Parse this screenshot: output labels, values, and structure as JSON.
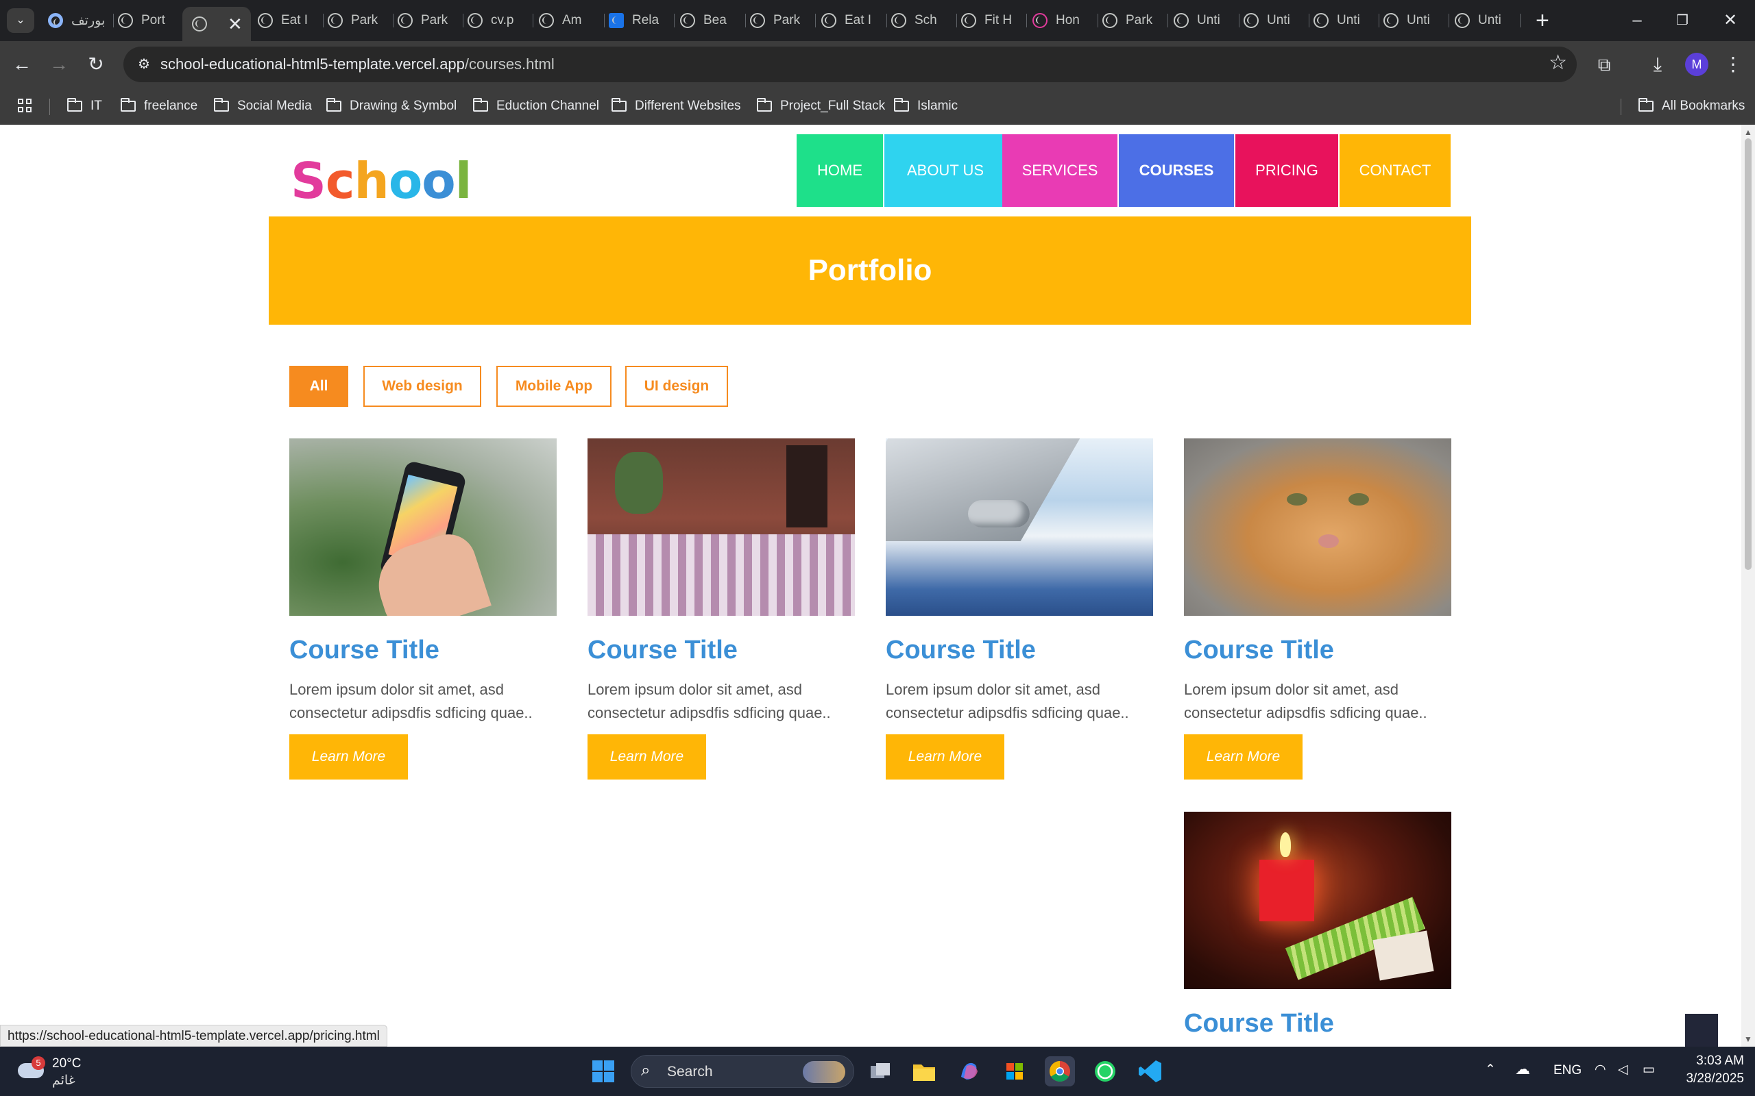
{
  "browser": {
    "tabs": [
      {
        "title": "بورتف",
        "favicon": "circle-icon"
      },
      {
        "title": "Port",
        "favicon": "globe-icon"
      },
      {
        "title": "",
        "favicon": "globe-icon",
        "active": true
      },
      {
        "title": "Eat I",
        "favicon": "globe-icon"
      },
      {
        "title": "Park",
        "favicon": "globe-icon"
      },
      {
        "title": "Park",
        "favicon": "globe-icon"
      },
      {
        "title": "cv.p",
        "favicon": "globe-icon"
      },
      {
        "title": "Am",
        "favicon": "spade-icon"
      },
      {
        "title": "Rela",
        "favicon": "play-icon"
      },
      {
        "title": "Bea",
        "favicon": "spade-icon"
      },
      {
        "title": "Park",
        "favicon": "globe-icon"
      },
      {
        "title": "Eat I",
        "favicon": "globe-icon"
      },
      {
        "title": "Sch",
        "favicon": "globe-icon"
      },
      {
        "title": "Fit H",
        "favicon": "globe-icon"
      },
      {
        "title": "Hon",
        "favicon": "angular-icon"
      },
      {
        "title": "Park",
        "favicon": "globe-icon"
      },
      {
        "title": "Unti",
        "favicon": "globe-icon"
      },
      {
        "title": "Unti",
        "favicon": "globe-icon"
      },
      {
        "title": "Unti",
        "favicon": "globe-icon"
      },
      {
        "title": "Unti",
        "favicon": "globe-icon"
      },
      {
        "title": "Unti",
        "favicon": "globe-icon"
      }
    ],
    "url_host": "school-educational-html5-template.vercel.app",
    "url_path": "/courses.html",
    "avatar_letter": "M",
    "bookmarks": [
      "IT",
      "freelance",
      "Social Media",
      "Drawing & Symbol",
      "Eduction Channel",
      "Different Websites",
      "Project_Full Stack",
      "Islamic"
    ],
    "all_bookmarks": "All Bookmarks",
    "status_url": "https://school-educational-html5-template.vercel.app/pricing.html"
  },
  "site": {
    "logo_letters": [
      {
        "ch": "S",
        "color": "#e23b9c"
      },
      {
        "ch": "c",
        "color": "#f25a2c"
      },
      {
        "ch": "h",
        "color": "#f4a51f"
      },
      {
        "ch": "o",
        "color": "#29b6e8"
      },
      {
        "ch": "o",
        "color": "#3b8fd6"
      },
      {
        "ch": "l",
        "color": "#7ab43f"
      }
    ],
    "nav": [
      {
        "label": "HOME",
        "color": "#1ee08a"
      },
      {
        "label": "ABOUT US",
        "color": "#2fd3ef"
      },
      {
        "label": "SERVICES",
        "color": "#e93bb4"
      },
      {
        "label": "COURSES",
        "color": "#4c6fe6",
        "active": true
      },
      {
        "label": "PRICING",
        "color": "#e8125c"
      },
      {
        "label": "CONTACT",
        "color": "#ffb606"
      }
    ],
    "banner_title": "Portfolio",
    "filters": [
      {
        "label": "All",
        "active": true
      },
      {
        "label": "Web design"
      },
      {
        "label": "Mobile App"
      },
      {
        "label": "UI design"
      }
    ],
    "cards": [
      {
        "title": "Course Title",
        "text": "Lorem ipsum dolor sit amet, asd consectetur adipsdfis sdficing quae..",
        "button": "Learn More",
        "image": "smartphone-photo"
      },
      {
        "title": "Course Title",
        "text": "Lorem ipsum dolor sit amet, asd consectetur adipsdfis sdficing quae..",
        "button": "Learn More",
        "image": "cafe-photo"
      },
      {
        "title": "Course Title",
        "text": "Lorem ipsum dolor sit amet, asd consectetur adipsdfis sdficing quae..",
        "button": "Learn More",
        "image": "airplane-wing-photo"
      },
      {
        "title": "Course Title",
        "text": "Lorem ipsum dolor sit amet, asd consectetur adipsdfis sdficing quae..",
        "button": "Learn More",
        "image": "cat-photo"
      },
      {
        "title": "Course Title",
        "image": "candle-photo"
      }
    ],
    "colors": {
      "accent": "#ffb606",
      "filter": "#f68b1f",
      "title": "#3b8fd6"
    }
  },
  "taskbar": {
    "weather_temp": "20°C",
    "weather_desc": "غائم",
    "weather_badge": "5",
    "search_label": "Search",
    "lang": "ENG",
    "time": "3:03 AM",
    "date": "3/28/2025"
  }
}
